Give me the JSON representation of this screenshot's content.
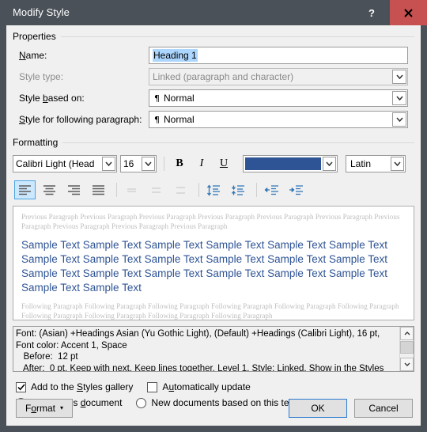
{
  "titlebar": {
    "title": "Modify Style",
    "help_label": "?",
    "close_label": "✕"
  },
  "properties": {
    "group_label": "Properties",
    "name": {
      "label": "Name:",
      "value": "Heading 1"
    },
    "style_type": {
      "label": "Style type:",
      "value": "Linked (paragraph and character)"
    },
    "style_based_on": {
      "label": "Style based on:",
      "value": "Normal",
      "marker": "¶"
    },
    "style_following": {
      "label": "Style for following paragraph:",
      "value": "Normal",
      "marker": "¶"
    }
  },
  "formatting": {
    "group_label": "Formatting",
    "font_name": "Calibri Light (Head",
    "font_size": "16",
    "bold_label": "B",
    "italic_label": "I",
    "underline_label": "U",
    "font_color": "#2f5496",
    "script": "Latin",
    "icons": {
      "align_left": "align-left-icon",
      "align_center": "align-center-icon",
      "align_right": "align-right-icon",
      "align_justify": "align-justify-icon",
      "line_spacing_single": "line-spacing-single-icon",
      "line_spacing_15": "line-spacing-1-5-icon",
      "line_spacing_double": "line-spacing-double-icon",
      "space_before": "increase-paragraph-spacing-icon",
      "space_after": "decrease-paragraph-spacing-icon",
      "decrease_indent": "decrease-indent-icon",
      "increase_indent": "increase-indent-icon"
    }
  },
  "preview": {
    "previous_paragraph": "Previous Paragraph Previous Paragraph Previous Paragraph Previous Paragraph Previous Paragraph Previous Paragraph Previous Paragraph Previous Paragraph Previous Paragraph Previous Paragraph",
    "sample_text": "Sample Text Sample Text Sample Text Sample Text Sample Text Sample Text Sample Text Sample Text Sample Text Sample Text Sample Text Sample Text Sample Text Sample Text Sample Text Sample Text Sample Text Sample Text Sample Text Sample Text",
    "following_paragraph": "Following Paragraph Following Paragraph Following Paragraph Following Paragraph Following Paragraph Following Paragraph Following Paragraph Following Paragraph Following Paragraph Following Paragraph"
  },
  "description": {
    "text": "Font: (Asian) +Headings Asian (Yu Gothic Light), (Default) +Headings (Calibri Light), 16 pt,\nFont color: Accent 1, Space\n   Before:  12 pt\n   After:  0 pt, Keep with next, Keep lines together, Level 1, Style: Linked, Show in the Styles"
  },
  "options": {
    "add_to_gallery": {
      "label": "Add to the Styles gallery",
      "checked": true
    },
    "automatically_update": {
      "label": "Automatically update",
      "checked": false
    },
    "only_this_document": {
      "label": "Only in this document",
      "selected": true
    },
    "new_documents": {
      "label": "New documents based on this template",
      "selected": false
    }
  },
  "buttons": {
    "format": "Format",
    "format_caret": "▾",
    "ok": "OK",
    "cancel": "Cancel"
  }
}
